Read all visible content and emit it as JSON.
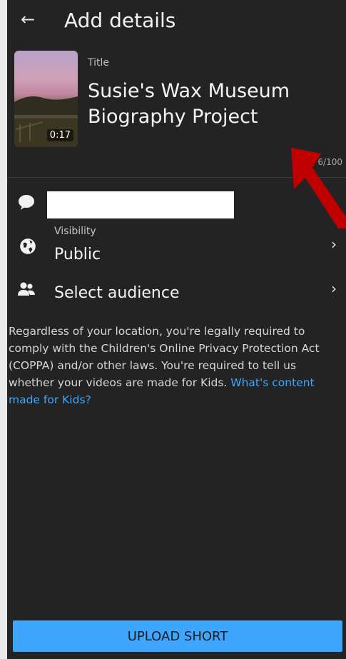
{
  "header": {
    "title": "Add details"
  },
  "video": {
    "duration": "0:17"
  },
  "title_field": {
    "label": "Title",
    "value": "Susie's Wax Museum Biography Project",
    "counter": "6/100"
  },
  "description_field": {
    "value": ""
  },
  "visibility": {
    "label": "Visibility",
    "value": "Public"
  },
  "audience": {
    "label": "Select audience"
  },
  "notice": {
    "text": "Regardless of your location, you're legally required to comply with the Children's Online Privacy Protection Act (COPPA) and/or other laws. You're required to tell us whether your videos are made for Kids. ",
    "link": "What's content made for Kids?"
  },
  "footer": {
    "upload_label": "UPLOAD SHORT"
  },
  "colors": {
    "accent": "#3ea6ff",
    "background": "#232323",
    "annotation_arrow": "#c00000"
  },
  "icons": [
    "back-arrow-icon",
    "globe-icon",
    "people-icon",
    "chevron-right-icon",
    "description-bubble-icon"
  ]
}
